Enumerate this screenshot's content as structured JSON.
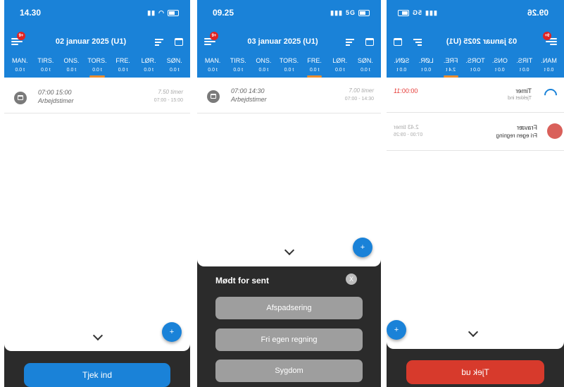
{
  "days": [
    {
      "label": "MAN.",
      "value": "0.0 t"
    },
    {
      "label": "TIRS.",
      "value": "0.0 t"
    },
    {
      "label": "ONS.",
      "value": "0.0 t"
    },
    {
      "label": "TORS.",
      "value": "0.0 t"
    },
    {
      "label": "FRE.",
      "value": "0.0 t"
    },
    {
      "label": "LØR.",
      "value": "0.0 t"
    },
    {
      "label": "SØN.",
      "value": "0.0 t"
    }
  ],
  "screen1": {
    "time": "14.30",
    "badge": "9+",
    "date": "02 januar 2025 (U1)",
    "selected_day": 3,
    "entry": {
      "time": "07:00 15:00",
      "type": "Arbejdstimer",
      "hours": "7.50 timer",
      "range": "07:00 - 15:00"
    },
    "fab": "+",
    "button": "Tjek ind",
    "button_color": "#1a82d8"
  },
  "screen2": {
    "time": "09.25",
    "network": "5G",
    "badge": "9+",
    "date": "03 januar 2025 (U1)",
    "selected_day": 4,
    "entry": {
      "time": "07:00 14:30",
      "type": "Arbejdstimer",
      "hours": "7.00 timer",
      "range": "07:00 - 14:30"
    },
    "fab": "+",
    "sheet": {
      "title": "Mødt for sent",
      "close": "X",
      "options": [
        "Afspadsering",
        "Fri egen regning",
        "Sygdom"
      ]
    }
  },
  "screen3": {
    "time": "09.26",
    "network": "5G",
    "badge": "9+",
    "date": "03 januar 2025 (U1)",
    "selected_day": 4,
    "fre_value": "2.4 t",
    "timer": {
      "label": "Timer",
      "sub": "Tjekket ind",
      "value": "00:00:11"
    },
    "absence": {
      "label": "Fravær",
      "sub": "Fri egen regning",
      "hours": "2.43 timer",
      "range": "07:00 - 09:26"
    },
    "fab": "+",
    "button": "Tjek ud",
    "button_color": "#d73a2c"
  }
}
